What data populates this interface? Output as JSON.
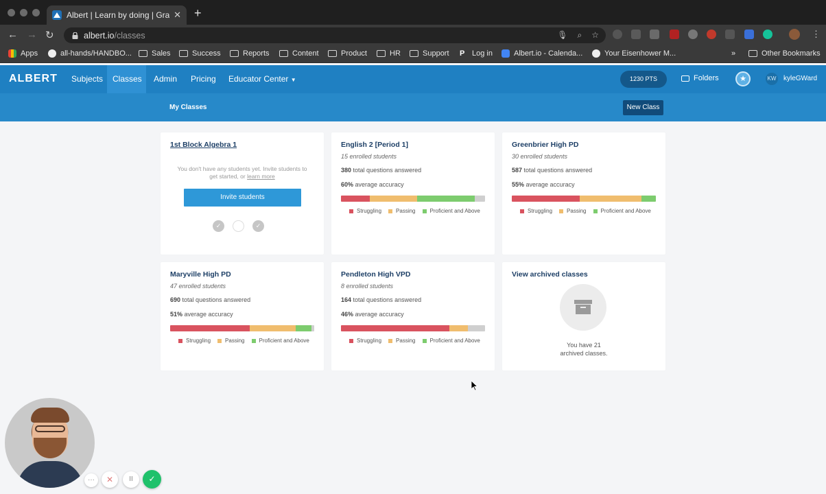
{
  "browser": {
    "tab_title": "Albert | Learn by doing | Grades",
    "url_host": "albert.io",
    "url_path": "/classes",
    "new_tab": "+",
    "close": "✕",
    "bookmarks": [
      {
        "label": "Apps",
        "icon": "apps-grid-icon"
      },
      {
        "label": "all-hands/HANDBO...",
        "icon": "github-icon"
      },
      {
        "label": "Sales",
        "icon": "folder-icon"
      },
      {
        "label": "Success",
        "icon": "folder-icon"
      },
      {
        "label": "Reports",
        "icon": "folder-icon"
      },
      {
        "label": "Content",
        "icon": "folder-icon"
      },
      {
        "label": "Product",
        "icon": "folder-icon"
      },
      {
        "label": "HR",
        "icon": "folder-icon"
      },
      {
        "label": "Support",
        "icon": "folder-icon"
      },
      {
        "label": "Log in",
        "icon": "p-icon"
      },
      {
        "label": "Albert.io - Calenda...",
        "icon": "calendar-icon"
      },
      {
        "label": "Your Eisenhower M...",
        "icon": "e-icon"
      }
    ],
    "bookmarks_overflow": "»",
    "other_bookmarks": "Other Bookmarks"
  },
  "header": {
    "brand": "ALBERT",
    "nav": [
      {
        "label": "Subjects",
        "active": false
      },
      {
        "label": "Classes",
        "active": true
      },
      {
        "label": "Admin",
        "active": false
      },
      {
        "label": "Pricing",
        "active": false
      },
      {
        "label": "Educator Center",
        "active": false
      }
    ],
    "points": "1230 PTS",
    "folders": "Folders",
    "user_initials": "KW",
    "username": "kyleGWard"
  },
  "subnav": {
    "title": "My Classes",
    "new_class": "New Class"
  },
  "legend": {
    "struggling": "Struggling",
    "passing": "Passing",
    "proficient": "Proficient and Above"
  },
  "colors": {
    "struggling": "#d9535f",
    "passing": "#f0bd6e",
    "proficient": "#7dcc6e",
    "unanswered": "#cfcfcf",
    "brand": "#1f80c2"
  },
  "classes": [
    {
      "name": "1st Block Algebra 1",
      "empty_message": "You don't have any students yet. Invite students to get started, or",
      "learn_more": "learn more",
      "invite": "Invite students"
    },
    {
      "name": "English 2 [Period 1]",
      "enrolled": "15 enrolled students",
      "questions_value": "380",
      "questions_label": "total questions answered",
      "accuracy_value": "60%",
      "accuracy_label": "average accuracy",
      "bar": {
        "struggling": 0.2,
        "passing": 0.33,
        "proficient": 0.4,
        "unanswered": 0.07
      }
    },
    {
      "name": "Greenbrier High PD",
      "enrolled": "30 enrolled students",
      "questions_value": "587",
      "questions_label": "total questions answered",
      "accuracy_value": "55%",
      "accuracy_label": "average accuracy",
      "bar": {
        "struggling": 0.47,
        "passing": 0.43,
        "proficient": 0.1,
        "unanswered": 0
      }
    },
    {
      "name": "Maryville High PD",
      "enrolled": "47 enrolled students",
      "questions_value": "690",
      "questions_label": "total questions answered",
      "accuracy_value": "51%",
      "accuracy_label": "average accuracy",
      "bar": {
        "struggling": 0.55,
        "passing": 0.32,
        "proficient": 0.11,
        "unanswered": 0.02
      }
    },
    {
      "name": "Pendleton High VPD",
      "enrolled": "8 enrolled students",
      "questions_value": "164",
      "questions_label": "total questions answered",
      "accuracy_value": "46%",
      "accuracy_label": "average accuracy",
      "bar": {
        "struggling": 0.75,
        "passing": 0.13,
        "proficient": 0,
        "unanswered": 0.12
      }
    }
  ],
  "archived": {
    "title": "View archived classes",
    "text_line1": "You have 21",
    "text_line2": "archived classes."
  },
  "recorder": {
    "more": "···",
    "cancel": "✕",
    "pause": "II",
    "done": "✓"
  }
}
